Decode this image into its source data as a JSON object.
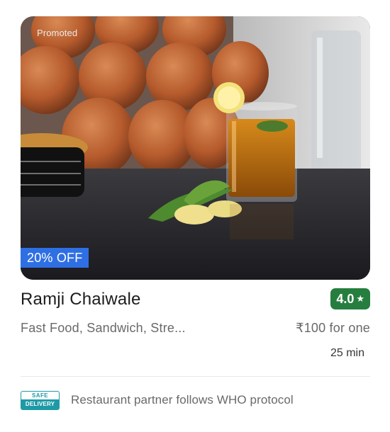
{
  "card": {
    "promoted_label": "Promoted",
    "offer_badge": "20% OFF",
    "restaurant_name": "Ramji Chaiwale",
    "rating": "4.0",
    "rating_icon": "star-icon",
    "cuisines": "Fast Food, Sandwich, Stre...",
    "price": "₹100 for one",
    "delivery_time": "25 min",
    "safety": {
      "badge_top": "SAFE",
      "badge_bottom": "DELIVERY",
      "text": "Restaurant partner follows WHO protocol"
    }
  },
  "colors": {
    "rating_bg": "#267e3e",
    "offer_bg": "#2f6fe4",
    "safe_badge": "#1e9aa6",
    "secondary_text": "#696969"
  }
}
